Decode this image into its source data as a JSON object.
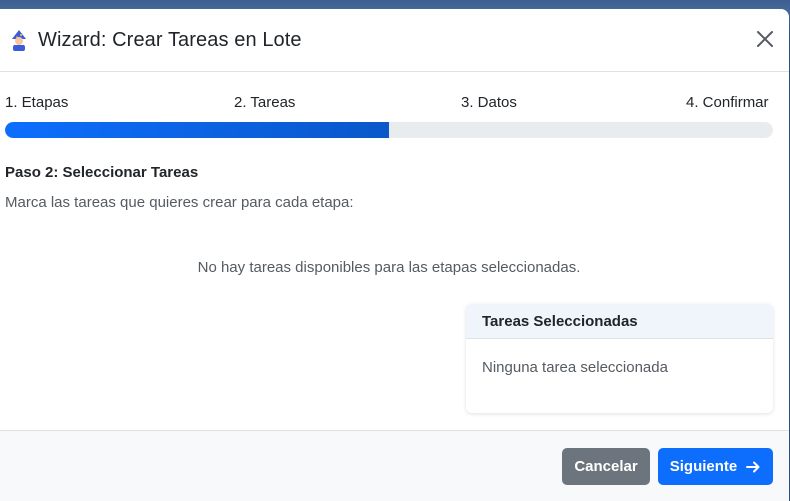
{
  "modal": {
    "title": "Wizard: Crear Tareas en Lote",
    "icon": "wizard-icon"
  },
  "steps": [
    {
      "label": "1. Etapas"
    },
    {
      "label": "2. Tareas"
    },
    {
      "label": "3. Datos"
    },
    {
      "label": "4. Confirmar"
    }
  ],
  "progress": {
    "value_percent": 50,
    "color": "#0d6efd"
  },
  "content": {
    "heading": "Paso 2: Seleccionar Tareas",
    "description": "Marca las tareas que quieres crear para cada etapa:",
    "empty_message": "No hay tareas disponibles para las etapas seleccionadas."
  },
  "selected_card": {
    "title": "Tareas Seleccionadas",
    "empty": "Ninguna tarea seleccionada"
  },
  "footer": {
    "cancel_label": "Cancelar",
    "next_label": "Siguiente"
  },
  "colors": {
    "primary": "#0d6efd",
    "secondary": "#6c757d"
  }
}
